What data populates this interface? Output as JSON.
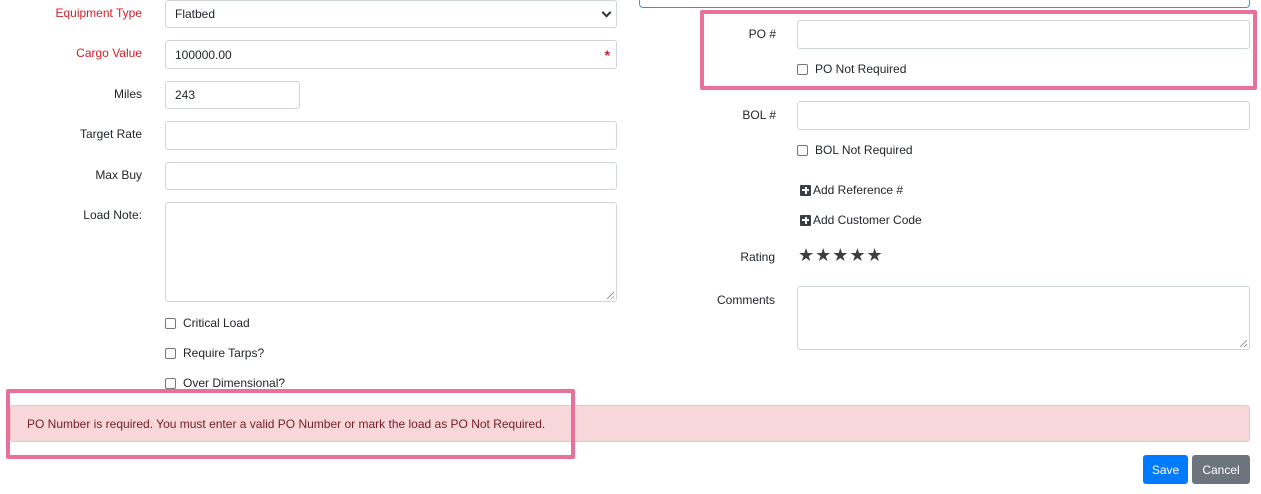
{
  "left": {
    "equipment_type": {
      "label": "Equipment Type",
      "value": "Flatbed"
    },
    "cargo_value": {
      "label": "Cargo Value",
      "value": "100000.00",
      "required_mark": "*"
    },
    "miles": {
      "label": "Miles",
      "value": "243"
    },
    "target_rate": {
      "label": "Target Rate",
      "value": ""
    },
    "max_buy": {
      "label": "Max Buy",
      "value": ""
    },
    "load_note": {
      "label": "Load Note:",
      "value": ""
    },
    "checkboxes": {
      "critical_load": "Critical Load",
      "require_tarps": "Require Tarps?",
      "over_dimensional": "Over Dimensional?"
    }
  },
  "right": {
    "po": {
      "label": "PO #",
      "value": "",
      "not_required_label": "PO Not Required"
    },
    "bol": {
      "label": "BOL #",
      "value": "",
      "not_required_label": "BOL Not Required"
    },
    "add_reference": "Add Reference #",
    "add_customer_code": "Add Customer Code",
    "rating": {
      "label": "Rating",
      "stars": "★★★★★",
      "value": 5
    },
    "comments": {
      "label": "Comments",
      "value": ""
    }
  },
  "alert": {
    "message": "PO Number is required. You must enter a valid PO Number or mark the load as PO Not Required."
  },
  "actions": {
    "save": "Save",
    "cancel": "Cancel"
  },
  "colors": {
    "required_label": "#d0202c",
    "highlight": "#e8709a",
    "alert_bg": "#f8d7da",
    "save_btn": "#007bff",
    "cancel_btn": "#6c757d"
  }
}
